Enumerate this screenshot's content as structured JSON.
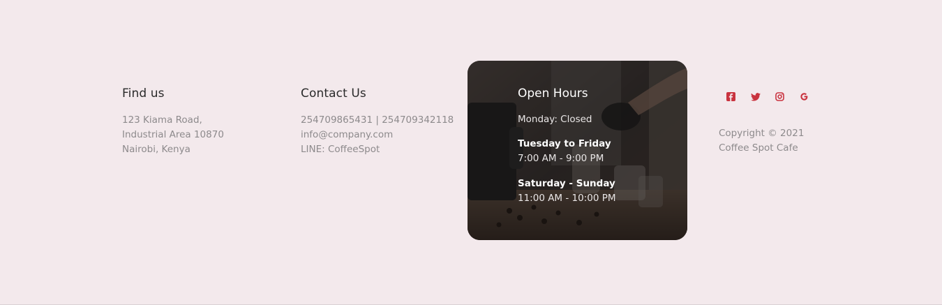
{
  "find_us": {
    "title": "Find us",
    "lines": [
      "123 Kiama Road,",
      "Industrial Area 10870",
      "Nairobi, Kenya"
    ]
  },
  "contact": {
    "title": "Contact Us",
    "phone": "254709865431 | 254709342118",
    "email": "info@company.com",
    "line": "LINE: CoffeeSpot"
  },
  "hours": {
    "title": "Open Hours",
    "monday": "Monday: Closed",
    "weekday_label": "Tuesday to Friday",
    "weekday_time": "7:00 AM - 9:00 PM",
    "weekend_label": "Saturday - Sunday",
    "weekend_time": "11:00 AM - 10:00 PM"
  },
  "social": {
    "icons": [
      "facebook-icon",
      "twitter-icon",
      "instagram-icon",
      "google-icon"
    ],
    "color": "#c9333f"
  },
  "copyright": {
    "line1": "Copyright © 2021",
    "line2": "Coffee Spot Cafe"
  },
  "colors": {
    "background": "#f3e9ec",
    "heading": "#2a2a2a",
    "muted_text": "#8d8a8c",
    "card_overlay": "#2b2726",
    "accent": "#c9333f"
  }
}
